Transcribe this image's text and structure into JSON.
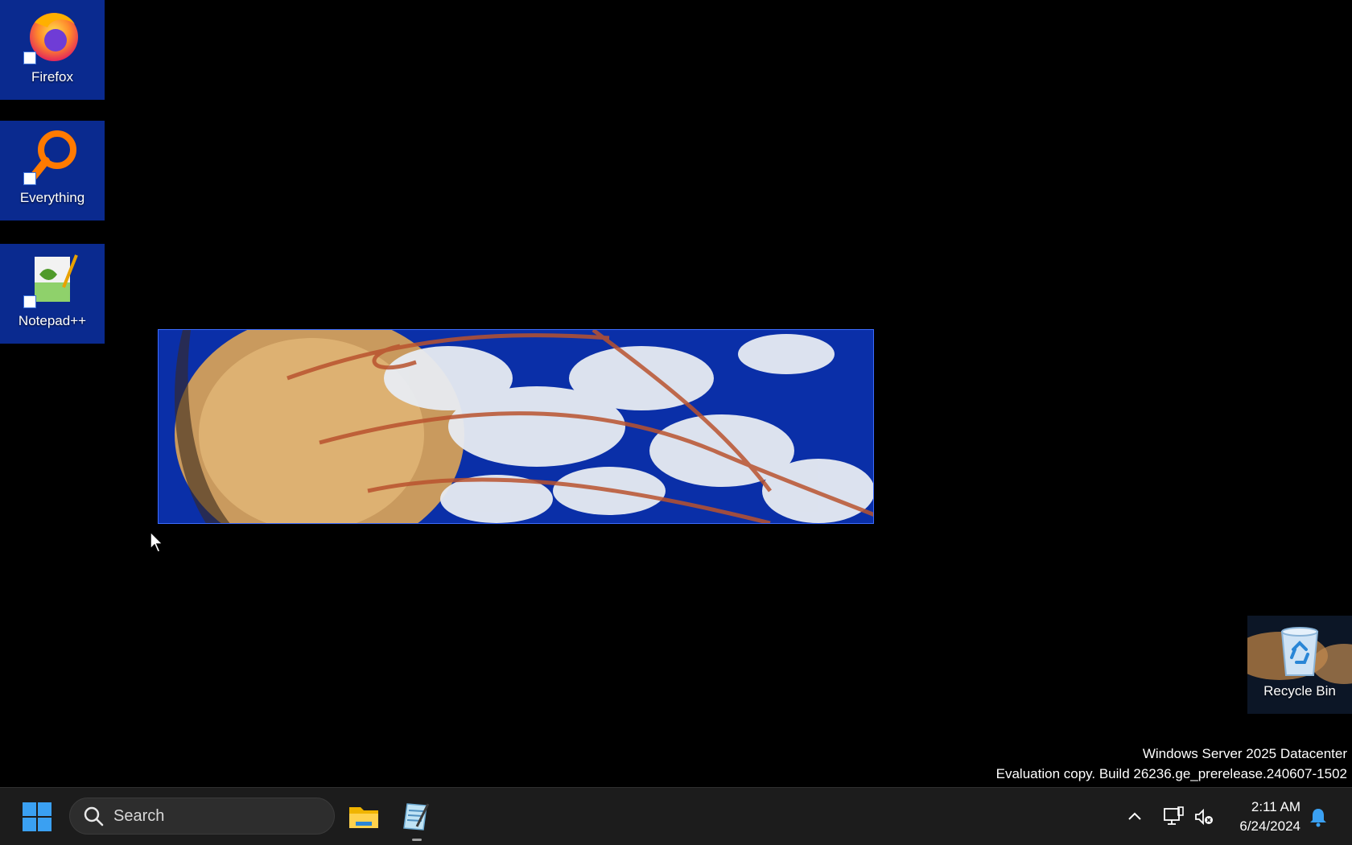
{
  "desktop": {
    "icons": [
      {
        "label": "Firefox",
        "icon": "firefox-icon"
      },
      {
        "label": "Everything",
        "icon": "everything-search-icon"
      },
      {
        "label": "Notepad++",
        "icon": "notepad-plus-plus-icon"
      }
    ],
    "recycle_bin": {
      "label": "Recycle Bin",
      "icon": "recycle-bin-icon"
    },
    "watermark": {
      "line1": "Windows Server 2025 Datacenter",
      "line2": "Evaluation copy. Build 26236.ge_prerelease.240607-1502"
    }
  },
  "taskbar": {
    "start_icon": "windows-start-icon",
    "search": {
      "placeholder": "Search",
      "icon": "search-icon"
    },
    "pinned": [
      {
        "name": "File Explorer",
        "icon": "folder-icon",
        "running": false
      },
      {
        "name": "Notepad",
        "icon": "notepad-icon",
        "running": true
      }
    ],
    "tray": {
      "chevron_icon": "chevron-up-icon",
      "network_icon": "network-monitor-icon",
      "volume_icon": "volume-muted-icon",
      "time": "2:11 AM",
      "date": "6/24/2024",
      "notification_icon": "bell-icon"
    }
  },
  "colors": {
    "icon_tile": "#0a2a8f",
    "taskbar": "#1c1c1c",
    "accent": "#0078d4"
  }
}
